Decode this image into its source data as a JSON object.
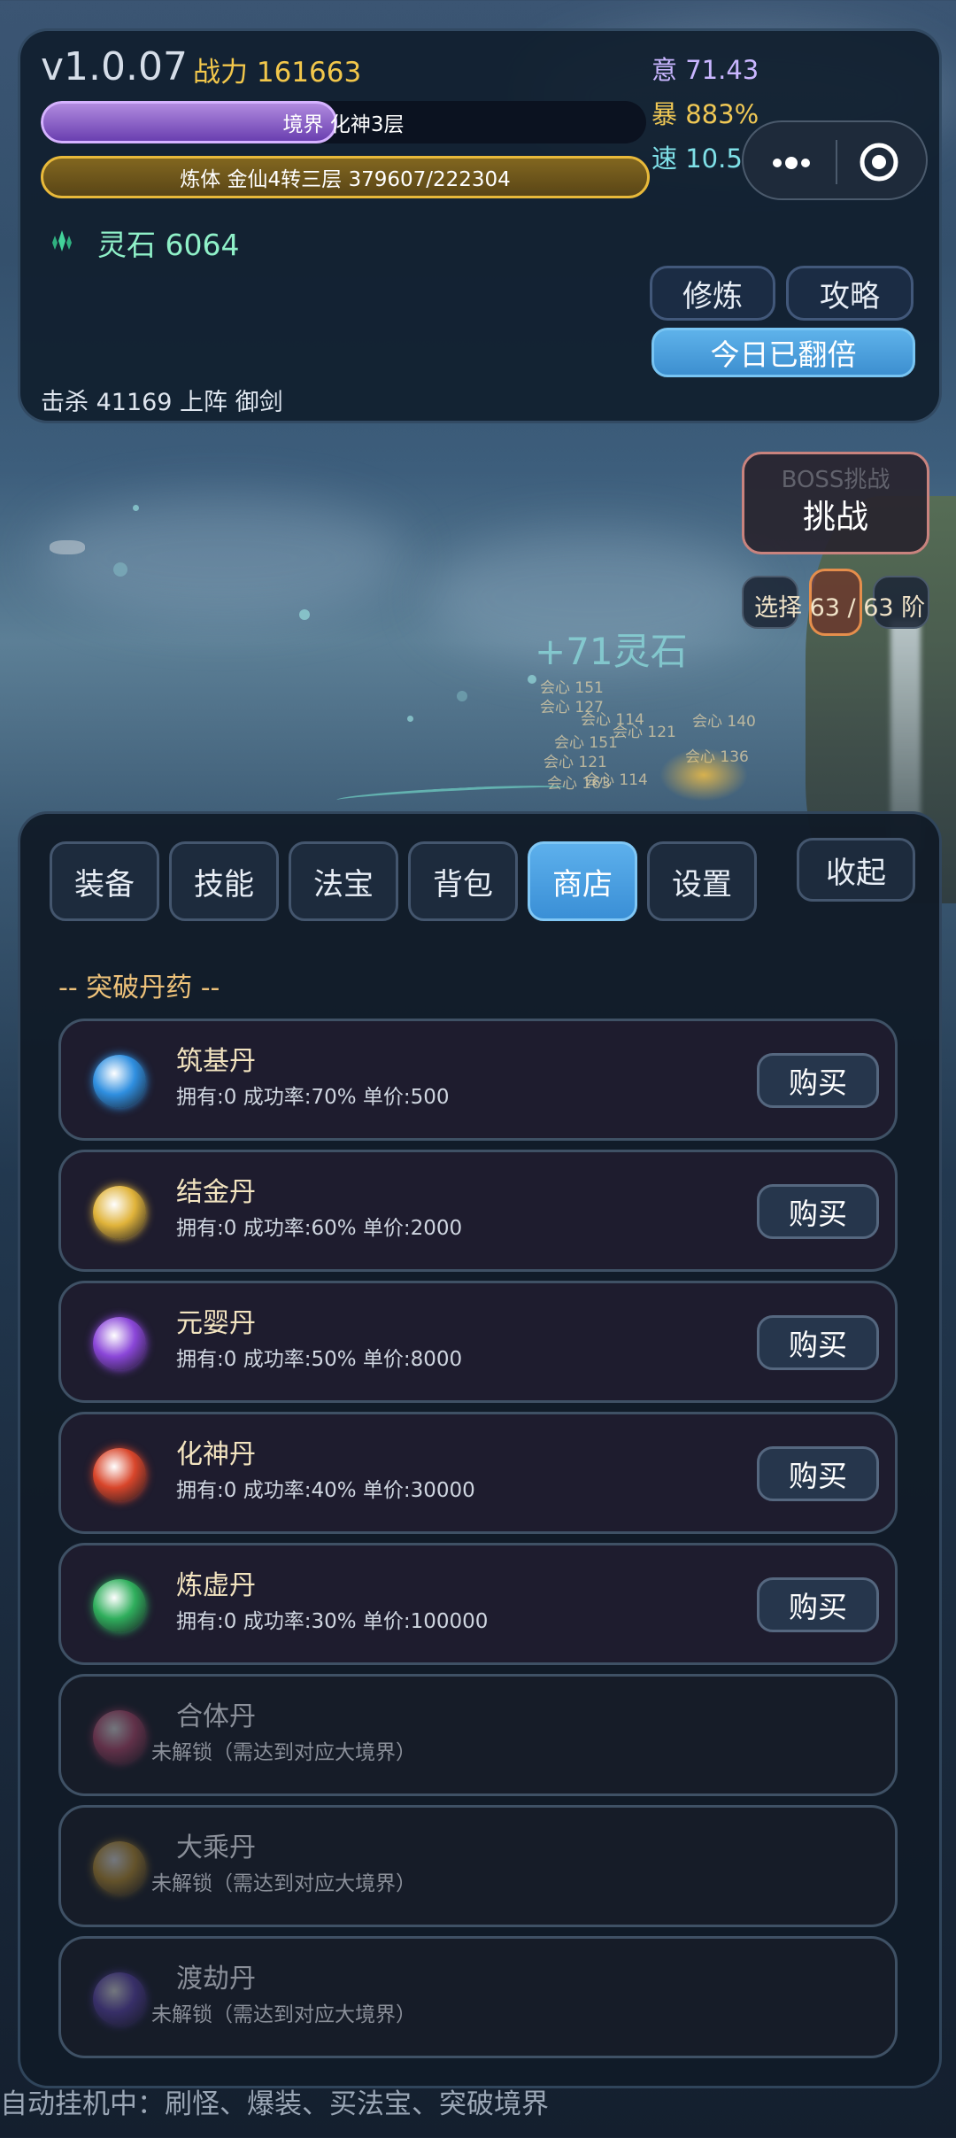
{
  "header": {
    "version": "v1.0.07",
    "power": "战力 161663",
    "stats": {
      "yi": "意 71.43",
      "bao": "暴 883%",
      "su": "速 10.52"
    },
    "realm_bar": {
      "label": "境界 化神3层",
      "progress": 0.49
    },
    "body_bar": {
      "label": "炼体 金仙4转三层  379607/222304",
      "progress": 1.0
    },
    "spirit_stones": "灵石 6064",
    "kills": "击杀 41169   上阵 御剑",
    "btn_cultivate": "修炼",
    "btn_guide": "攻略",
    "btn_doubled": "今日已翻倍",
    "capsule": {
      "more_icon": "more-dots-icon",
      "close_icon": "target-circle-icon"
    }
  },
  "battle": {
    "boss_sub": "BOSS挑战",
    "boss_label": "挑战",
    "stage_select": "选择 63 / 63 阶",
    "float_gain": "+71灵石",
    "damage_popups": [
      "会心 151",
      "会心 127",
      "会心 114",
      "会心 121",
      "会心 140",
      "会心 151",
      "会心 114",
      "会心 163",
      "会心 121",
      "会心 136"
    ]
  },
  "tabs": [
    "装备",
    "技能",
    "法宝",
    "背包",
    "商店",
    "设置"
  ],
  "active_tab": "商店",
  "collapse_label": "收起",
  "shop": {
    "section_title": "-- 突破丹药 --",
    "buy_label": "购买",
    "items": [
      {
        "name": "筑基丹",
        "desc": "拥有:0  成功率:70%  单价:500",
        "locked": false,
        "icon": "yin-yang-pill-icon",
        "color": "#2f8fe0"
      },
      {
        "name": "结金丹",
        "desc": "拥有:0  成功率:60%  单价:2000",
        "locked": false,
        "icon": "golden-pill-icon",
        "color": "#e0b33a"
      },
      {
        "name": "元婴丹",
        "desc": "拥有:0  成功率:50%  单价:8000",
        "locked": false,
        "icon": "purple-pill-icon",
        "color": "#8a46d8"
      },
      {
        "name": "化神丹",
        "desc": "拥有:0  成功率:40%  单价:30000",
        "locked": false,
        "icon": "fire-dragon-pill-icon",
        "color": "#d8452a"
      },
      {
        "name": "炼虚丹",
        "desc": "拥有:0  成功率:30%  单价:100000",
        "locked": false,
        "icon": "green-swirl-pill-icon",
        "color": "#2fae5c"
      },
      {
        "name": "合体丹",
        "desc": "未解锁（需达到对应大境界）",
        "locked": true,
        "icon": "pink-yin-yang-pill-icon",
        "color": "#d0507a"
      },
      {
        "name": "大乘丹",
        "desc": "未解锁（需达到对应大境界）",
        "locked": true,
        "icon": "gold-lotus-pill-icon",
        "color": "#d8a530"
      },
      {
        "name": "渡劫丹",
        "desc": "未解锁（需达到对应大境界）",
        "locked": true,
        "icon": "lightning-pill-icon",
        "color": "#6a4cc8"
      }
    ]
  },
  "footer": "自动挂机中：刷怪、爆装、买法宝、突破境界"
}
